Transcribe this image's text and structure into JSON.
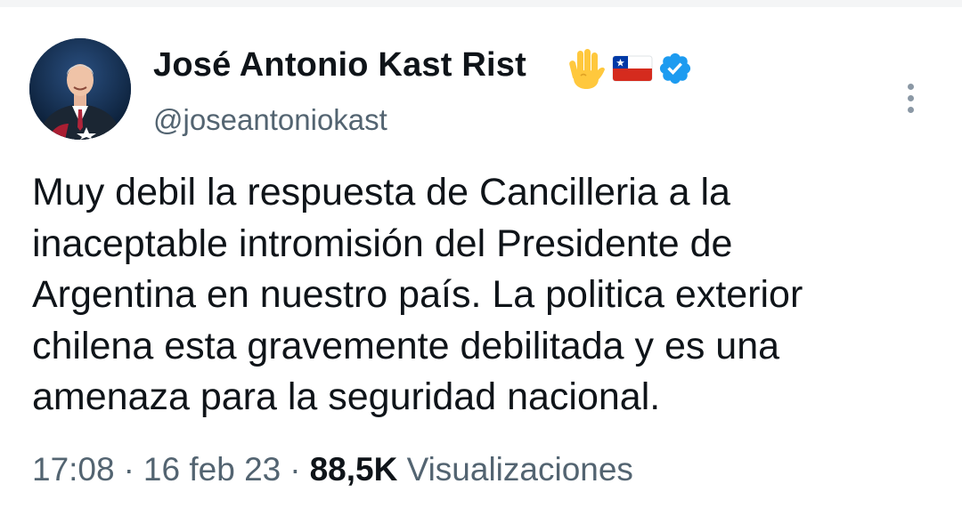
{
  "tweet": {
    "author_name": "José Antonio Kast Rist",
    "handle": "@joseantoniokast",
    "text": "Muy debil la respuesta de Cancilleria a la\ninaceptable intromisión del Presidente de\nArgentina en nuestro país. La politica exterior\nchilena esta gravemente debilitada y es una\namenaza para la seguridad nacional.",
    "time": "17:08",
    "date": "16 feb 23",
    "views_count": "88,5K",
    "views_label": "Visualizaciones",
    "separator": "·"
  },
  "icons": {
    "badges": [
      "raised-hand-emoji",
      "chile-flag-emoji",
      "verified-badge"
    ],
    "menu": "more-options-icon"
  },
  "colors": {
    "text_primary": "#0f1419",
    "text_secondary": "#536471",
    "verified_blue": "#1d9bf0",
    "background": "#ffffff"
  }
}
